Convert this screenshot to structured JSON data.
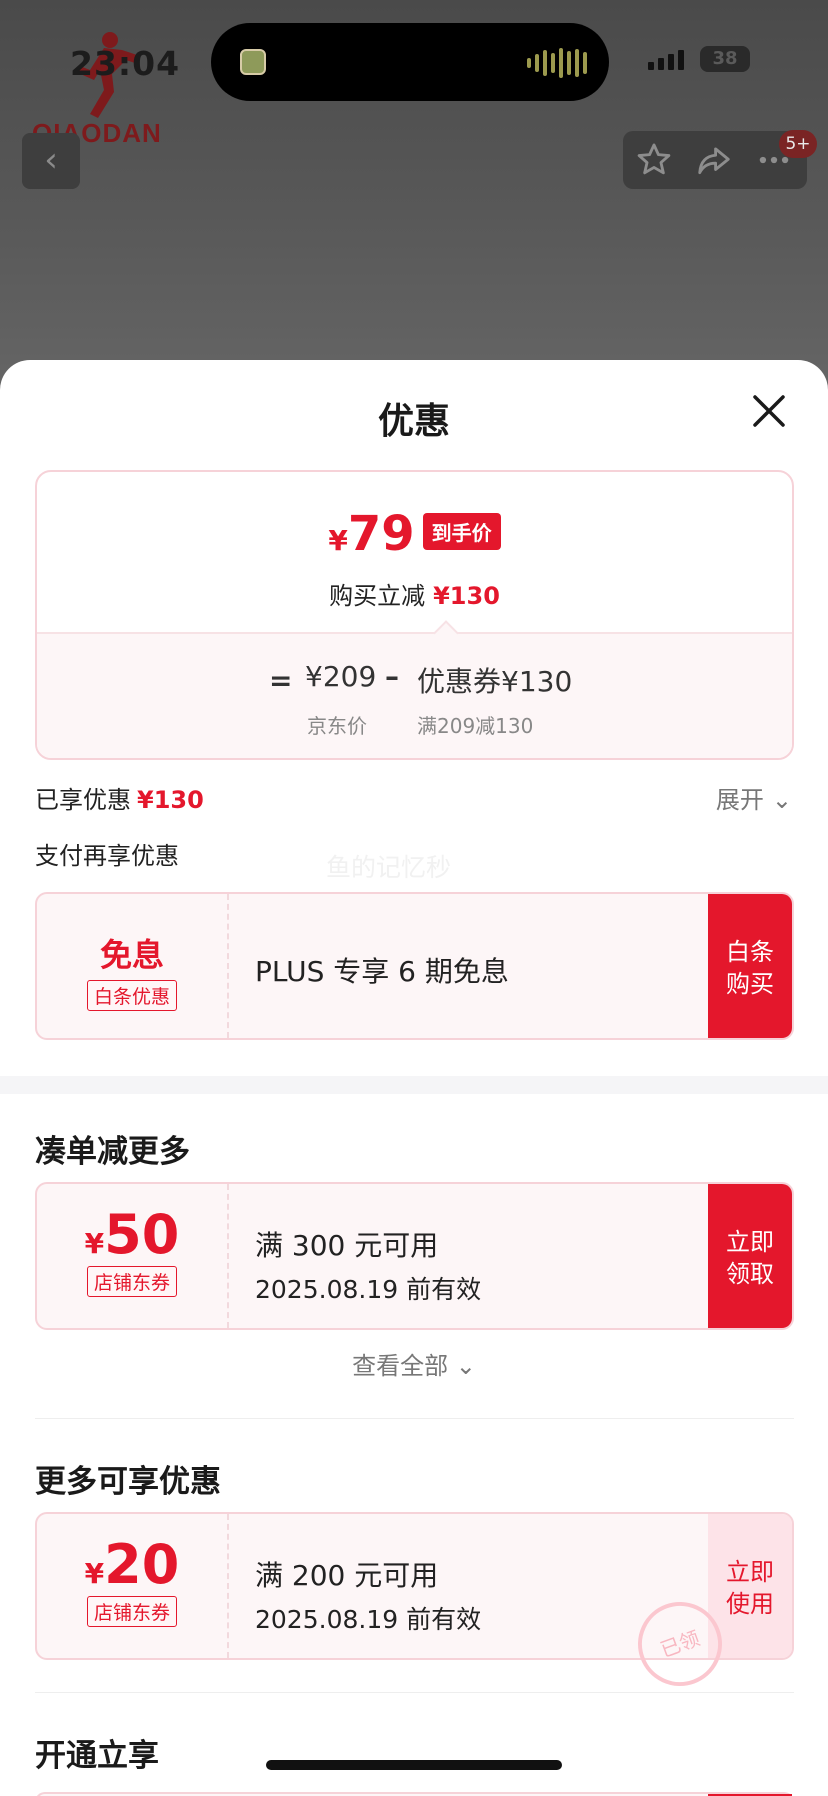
{
  "status_bar": {
    "time": "23:04",
    "battery": "38"
  },
  "brand": {
    "name": "QIAODAN"
  },
  "header": {
    "badge": "5+"
  },
  "sheet": {
    "title": "优惠",
    "price_card": {
      "currency": "¥",
      "final_price": "79",
      "final_tag": "到手价",
      "reduction_label": "购买立减",
      "reduction_value": "¥130",
      "equals": "=",
      "original_price": "¥209",
      "minus": "–",
      "coupon_amount": "优惠券¥130",
      "original_label": "京东价",
      "coupon_condition": "满209减130"
    },
    "enjoyed": {
      "label": "已享优惠",
      "value": "¥130",
      "expand": "展开"
    },
    "pay_more": {
      "title": "支付再享优惠",
      "watermark": "鱼的记忆秒"
    },
    "baitiao_coupon": {
      "main": "免息",
      "tag": "白条优惠",
      "desc": "PLUS 专享 6 期免息",
      "button_line1": "白条",
      "button_line2": "购买"
    },
    "section_more": {
      "title": "凑单减更多",
      "coupon": {
        "currency": "¥",
        "value": "50",
        "tag": "店铺东券",
        "condition": "满 300 元可用",
        "valid": "2025.08.19 前有效",
        "button_line1": "立即",
        "button_line2": "领取"
      },
      "see_all": "查看全部"
    },
    "section_available": {
      "title": "更多可享优惠",
      "coupon": {
        "currency": "¥",
        "value": "20",
        "tag": "店铺东券",
        "condition": "满 200 元可用",
        "valid": "2025.08.19 前有效",
        "button_line1": "立即",
        "button_line2": "使用",
        "stamp": "已领"
      }
    },
    "section_open": {
      "title": "开通立享"
    }
  },
  "colors": {
    "accent": "#e4172c",
    "card_border": "#f6d2d8",
    "card_bg": "#fdf6f7"
  },
  "icons": [
    "back-icon",
    "star-icon",
    "share-icon",
    "more-icon",
    "close-icon",
    "chevron-down-icon"
  ]
}
